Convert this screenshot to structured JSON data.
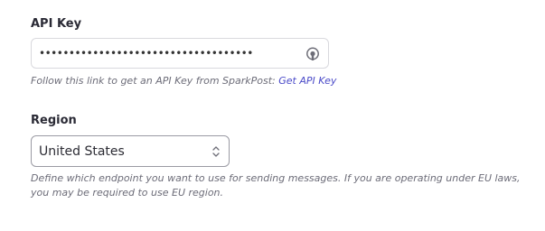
{
  "api_key": {
    "label": "API Key",
    "value": "••••••••••••••••••••••••••••••••••••",
    "help_text": "Follow this link to get an API Key from SparkPost: ",
    "help_link": "Get API Key",
    "icon": "eye-reveal-icon"
  },
  "region": {
    "label": "Region",
    "selected": "United States",
    "help_text": "Define which endpoint you want to use for sending messages. If you are operating under EU laws, you may be required to use EU region.",
    "icon": "up-down-chevron-icon"
  },
  "colors": {
    "link": "#4a4ac8",
    "label": "#2a2a35",
    "help": "#6c6c78",
    "border": "#d9d9de"
  }
}
